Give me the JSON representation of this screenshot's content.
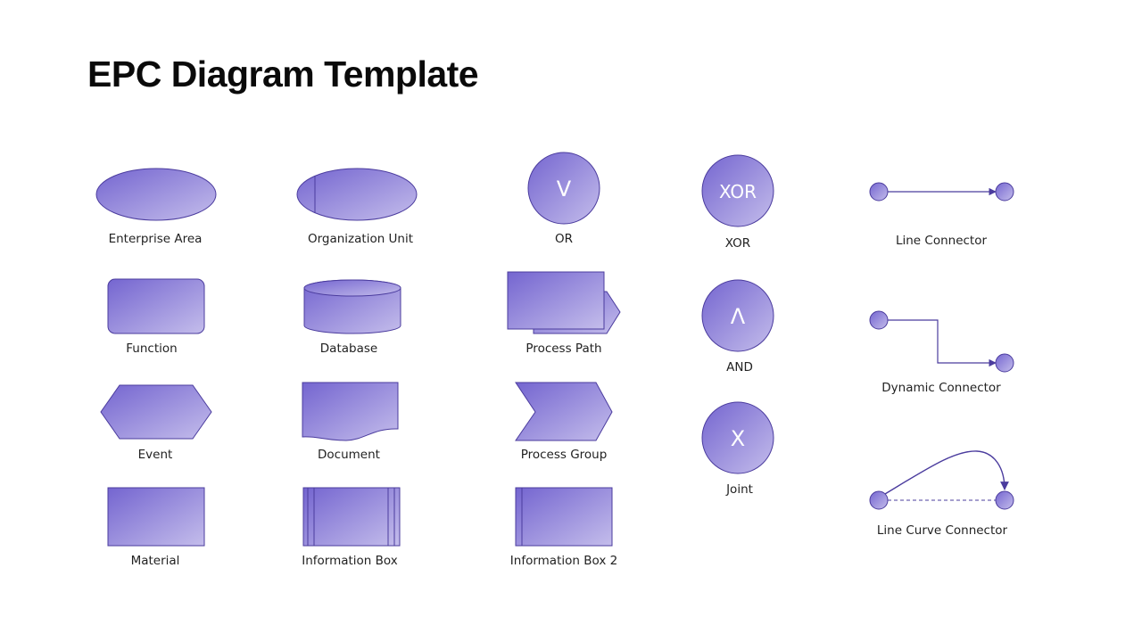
{
  "title": "EPC Diagram Template",
  "colors": {
    "fill_start": "#7465D0",
    "fill_end": "#C4BDEB",
    "stroke": "#4B3C9E",
    "label": "#222222",
    "glyph": "#FFFFFF"
  },
  "shapes": {
    "enterprise_area": "Enterprise Area",
    "organization_unit": "Organization Unit",
    "or": {
      "label": "OR",
      "symbol": "V"
    },
    "xor": {
      "label": "XOR",
      "symbol": "XOR"
    },
    "function": "Function",
    "database": "Database",
    "process_path": "Process Path",
    "and": {
      "label": "AND",
      "symbol": "Λ"
    },
    "event": "Event",
    "document": "Document",
    "process_group": "Process Group",
    "joint": {
      "label": "Joint",
      "symbol": "X"
    },
    "material": "Material",
    "information_box": "Information Box",
    "information_box_2": "Information Box 2"
  },
  "connectors": {
    "line": "Line Connector",
    "dynamic": "Dynamic Connector",
    "line_curve": "Line Curve Connector"
  }
}
